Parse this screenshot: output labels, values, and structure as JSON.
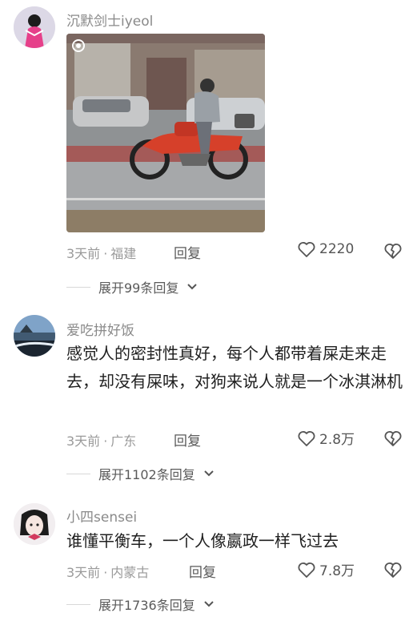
{
  "comments": [
    {
      "username": "沉默剑士iyeol",
      "time": "3天前",
      "location": "福建",
      "reply_label": "回复",
      "likes": "2220",
      "expand_label": "展开99条回复",
      "has_image": true
    },
    {
      "username": "爱吃拼好饭",
      "text": "感觉人的密封性真好，每个人都带着屎走来走去，却没有屎味，对狗来说人就是一个冰淇淋机",
      "time": "3天前",
      "location": "广东",
      "reply_label": "回复",
      "likes": "2.8万",
      "expand_label": "展开1102条回复"
    },
    {
      "username": "小四sensei",
      "text": "谁懂平衡车，一个人像嬴政一样飞过去",
      "time": "3天前",
      "location": "内蒙古",
      "reply_label": "回复",
      "likes": "7.8万",
      "expand_label": "展开1736条回复"
    }
  ],
  "meta_separator": "·",
  "colors": {
    "text": "#1f1f1f",
    "muted": "#9a9a9a",
    "bike_red": "#d6402a"
  },
  "icons": {
    "like": "heart-outline-icon",
    "dislike": "broken-heart-icon",
    "expand": "chevron-down-icon"
  }
}
